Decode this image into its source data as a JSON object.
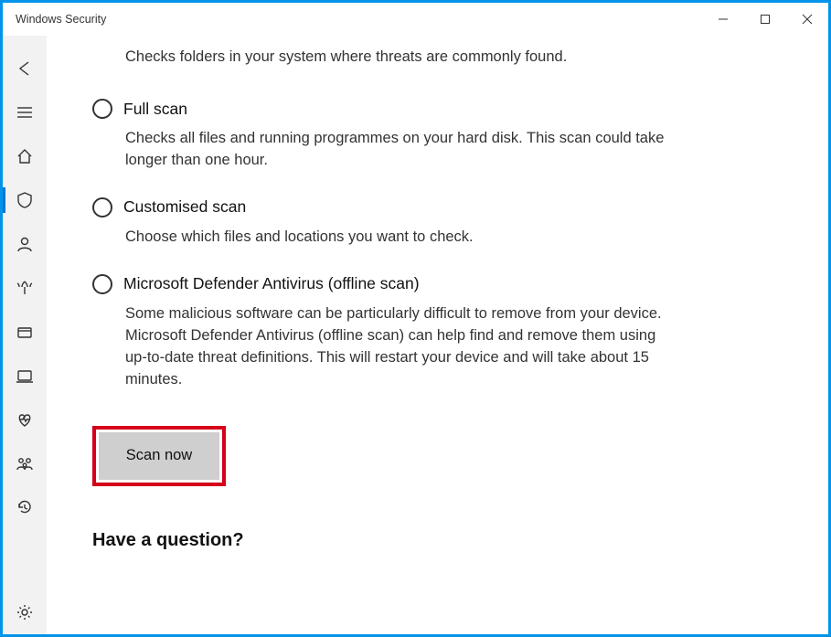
{
  "window": {
    "title": "Windows Security"
  },
  "sidebar": {
    "items": [
      {
        "id": "back"
      },
      {
        "id": "menu"
      },
      {
        "id": "home"
      },
      {
        "id": "virus",
        "selected": true
      },
      {
        "id": "account"
      },
      {
        "id": "firewall"
      },
      {
        "id": "appbrowser"
      },
      {
        "id": "device-security"
      },
      {
        "id": "device-performance"
      },
      {
        "id": "family"
      },
      {
        "id": "history"
      }
    ],
    "bottom": {
      "id": "settings"
    }
  },
  "content": {
    "prev_option_desc": "Checks folders in your system where threats are commonly found.",
    "options": [
      {
        "title": "Full scan",
        "desc": "Checks all files and running programmes on your hard disk. This scan could take longer than one hour."
      },
      {
        "title": "Customised scan",
        "desc": "Choose which files and locations you want to check."
      },
      {
        "title": "Microsoft Defender Antivirus (offline scan)",
        "desc": "Some malicious software can be particularly difficult to remove from your device. Microsoft Defender Antivirus (offline scan) can help find and remove them using up-to-date threat definitions. This will restart your device and will take about 15 minutes."
      }
    ],
    "scan_button": "Scan now",
    "question_heading": "Have a question?"
  }
}
